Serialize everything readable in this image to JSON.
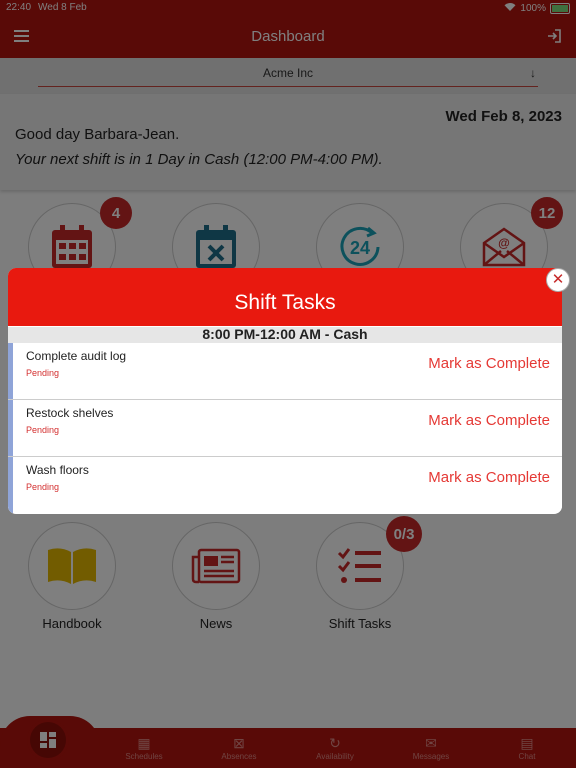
{
  "status_bar": {
    "time": "22:40",
    "date": "Wed 8 Feb",
    "battery": "100%"
  },
  "header": {
    "title": "Dashboard"
  },
  "company": {
    "selected": "Acme Inc"
  },
  "greeting": {
    "date": "Wed Feb 8, 2023",
    "hello": "Good day Barbara-Jean.",
    "next_shift": "Your next shift is in 1 Day in Cash (12:00 PM-4:00 PM)."
  },
  "tiles": {
    "schedules_badge": "4",
    "messages_badge": "12",
    "handbook": "Handbook",
    "news": "News",
    "shift_tasks": "Shift Tasks",
    "shift_tasks_badge": "0/3"
  },
  "modal": {
    "title": "Shift Tasks",
    "shift": "8:00 PM-12:00 AM - Cash",
    "tasks": [
      {
        "name": "Complete audit log",
        "status": "Pending",
        "action": "Mark as Complete"
      },
      {
        "name": "Restock shelves",
        "status": "Pending",
        "action": "Mark as Complete"
      },
      {
        "name": "Wash floors",
        "status": "Pending",
        "action": "Mark as Complete"
      }
    ]
  },
  "bottom_nav": {
    "schedules": "Schedules",
    "absences": "Absences",
    "availability": "Availability",
    "messages": "Messages",
    "chat": "Chat"
  },
  "colors": {
    "brand": "#b3140e",
    "modal_header": "#e8190f",
    "badge": "#c62828"
  },
  "icons": [
    "menu-icon",
    "logout-icon",
    "calendar-icon",
    "calendar-x-icon",
    "availability-24-icon",
    "email-icon",
    "book-icon",
    "news-icon",
    "checklist-icon",
    "close-icon",
    "home-grid-icon",
    "chat-icon"
  ]
}
